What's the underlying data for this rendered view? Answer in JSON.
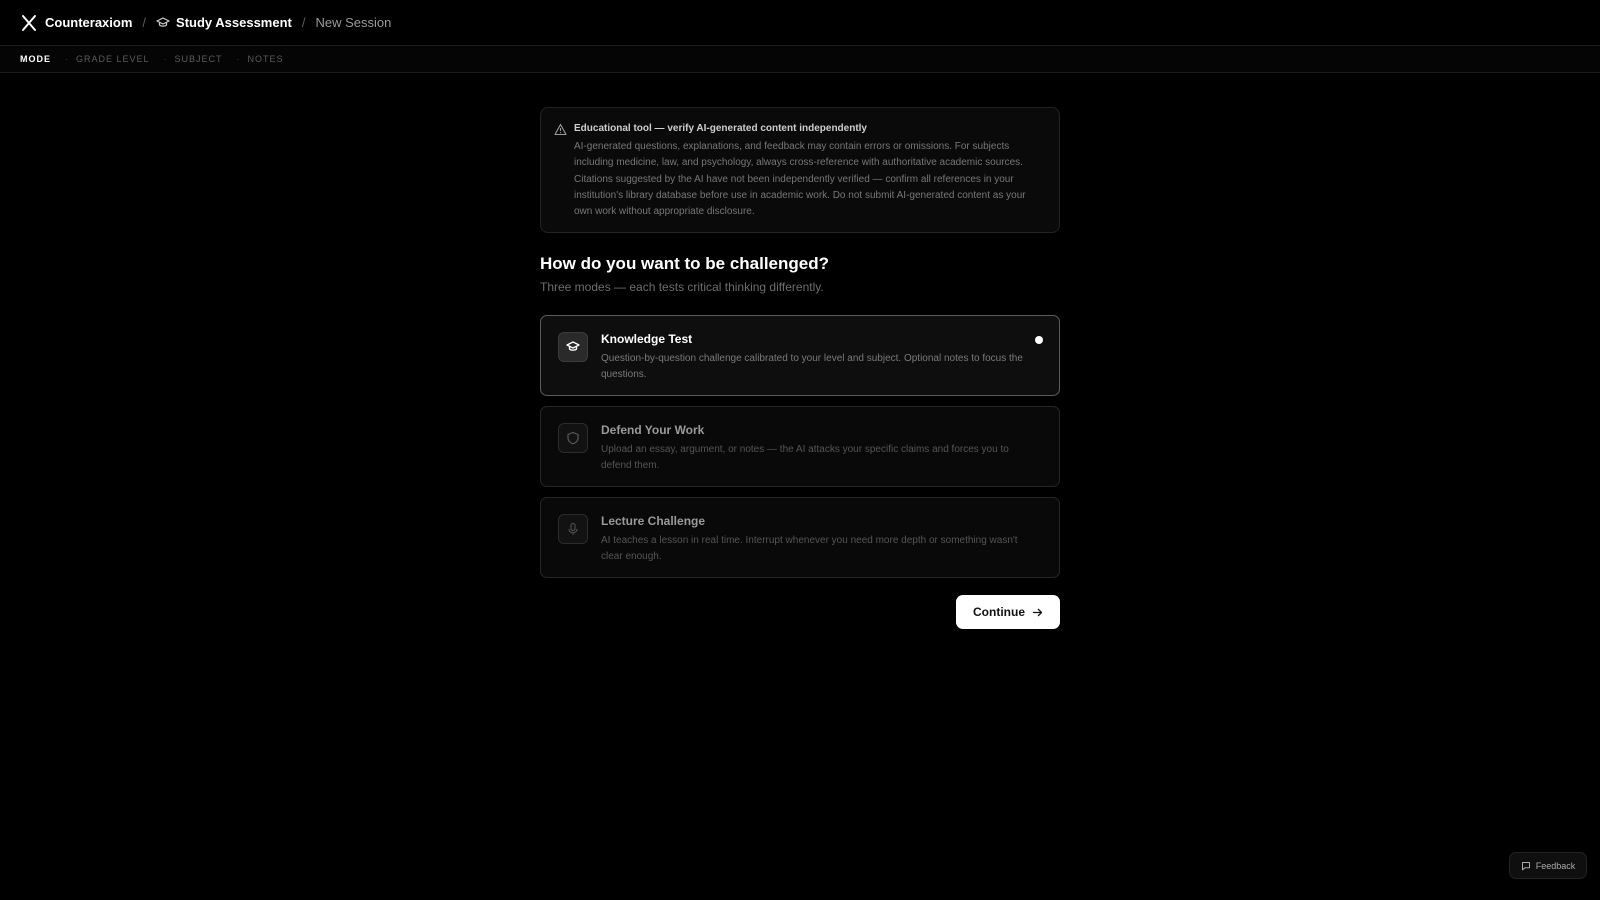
{
  "header": {
    "brand": "Counteraxiom",
    "separator": "/",
    "crumbs": {
      "section": "Study Assessment",
      "current": "New Session"
    },
    "icons": {
      "logo": "x-logo-icon",
      "section": "graduation-cap-icon"
    }
  },
  "steps": [
    {
      "label": "MODE",
      "active": true
    },
    {
      "label": "GRADE LEVEL",
      "active": false
    },
    {
      "label": "SUBJECT",
      "active": false
    },
    {
      "label": "NOTES",
      "active": false
    }
  ],
  "step_separator": "·",
  "warning": {
    "icon": "warning-triangle-icon",
    "title": "Educational tool — verify AI-generated content independently",
    "body": "AI-generated questions, explanations, and feedback may contain errors or omissions. For subjects including medicine, law, and psychology, always cross-reference with authoritative academic sources. Citations suggested by the AI have not been independently verified — confirm all references in your institution's library database before use in academic work. Do not submit AI-generated content as your own work without appropriate disclosure."
  },
  "heading": "How do you want to be challenged?",
  "subheading": "Three modes — each tests critical thinking differently.",
  "modes": [
    {
      "title": "Knowledge Test",
      "description": "Question-by-question challenge calibrated to your level and subject. Optional notes to focus the questions.",
      "icon": "graduation-cap-icon",
      "selected": true
    },
    {
      "title": "Defend Your Work",
      "description": "Upload an essay, argument, or notes — the AI attacks your specific claims and forces you to defend them.",
      "icon": "shield-icon",
      "selected": false
    },
    {
      "title": "Lecture Challenge",
      "description": "AI teaches a lesson in real time. Interrupt whenever you need more depth or something wasn't clear enough.",
      "icon": "microphone-icon",
      "selected": false
    }
  ],
  "actions": {
    "continue_label": "Continue",
    "continue_icon": "arrow-right-icon"
  },
  "feedback": {
    "label": "Feedback",
    "icon": "message-square-icon"
  },
  "colors": {
    "background": "#000000",
    "primary_button": "#ffffff",
    "selected_border": "#5a5a5a"
  }
}
